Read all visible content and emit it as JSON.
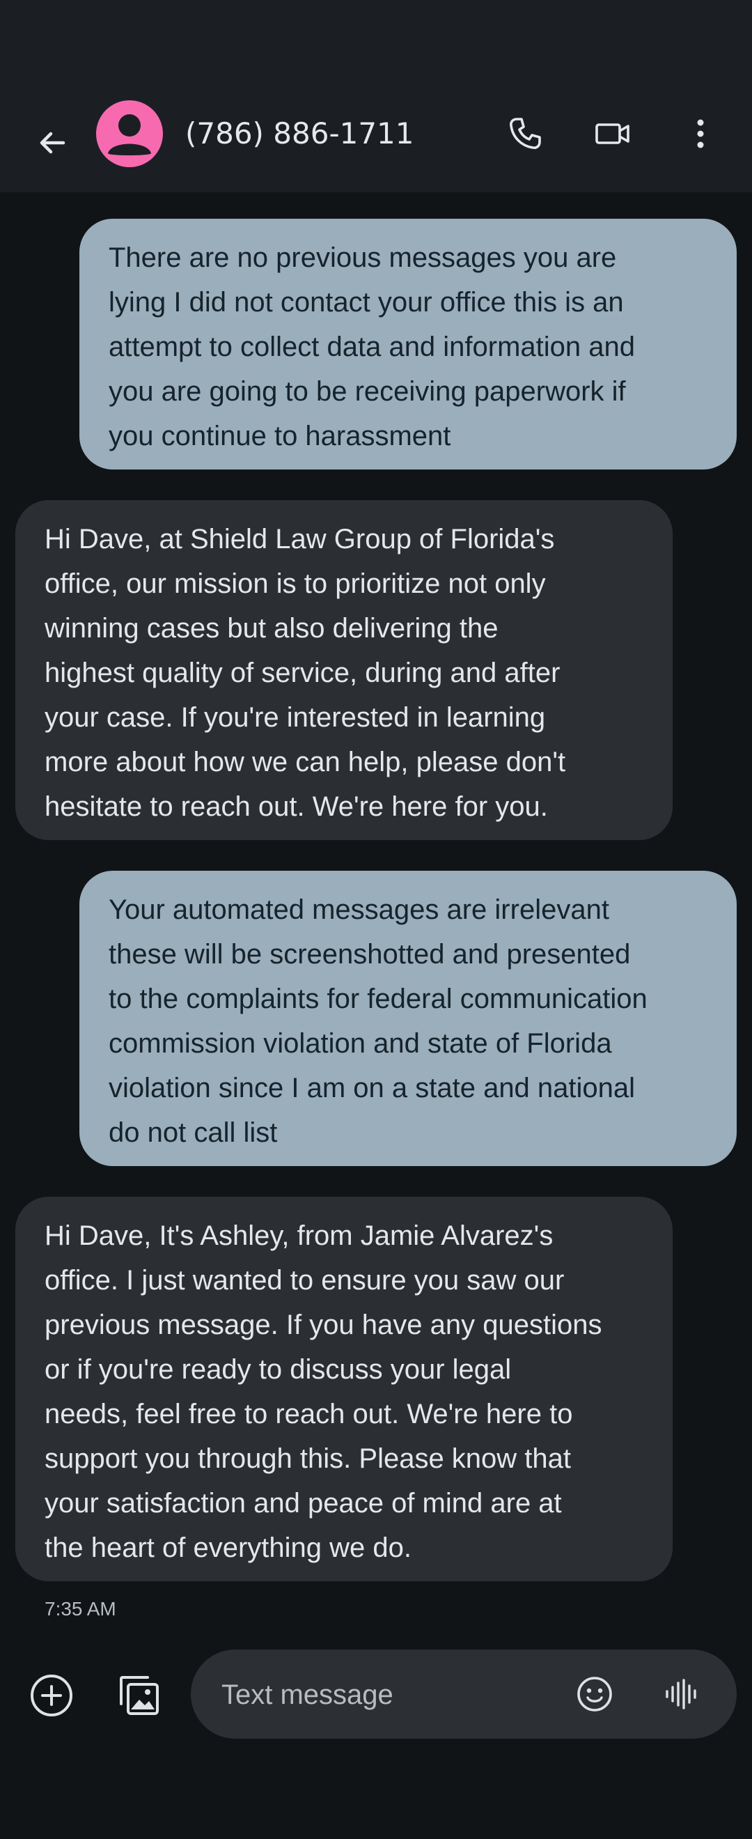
{
  "header": {
    "contact": "(786) 886-1711",
    "back_icon": "arrow-back-icon",
    "avatar_icon": "person-icon",
    "call_icon": "phone-icon",
    "video_icon": "video-camera-icon",
    "more_icon": "more-vert-icon"
  },
  "messages": [
    {
      "direction": "outgoing",
      "text": "There are no previous messages you are\nlying I did not contact your office this is an\nattempt to collect data and information and\nyou are going to be receiving paperwork if\nyou continue to harassment"
    },
    {
      "direction": "incoming",
      "text": "Hi Dave, at Shield Law Group of Florida's\noffice, our mission is to prioritize not only\nwinning cases but also delivering the\nhighest quality of service, during and after\nyour case. If you're interested in learning\nmore about how we can help, please don't\nhesitate to reach out. We're here for you."
    },
    {
      "direction": "outgoing",
      "text": "Your automated messages are irrelevant\nthese will be screenshotted and presented\nto the complaints for federal communication\ncommission violation and state of Florida\nviolation since I am on a state and national\ndo not call list"
    },
    {
      "direction": "incoming",
      "text": "Hi Dave, It's Ashley, from Jamie Alvarez's\noffice. I just wanted to ensure you saw our\nprevious message. If you have any questions\nor if you're ready to discuss your legal\nneeds, feel free to reach out. We're here to\nsupport you through this. Please know that\nyour satisfaction and peace of mind are at\nthe heart of everything we do."
    }
  ],
  "timestamp": "7:35 AM",
  "composer": {
    "placeholder": "Text message",
    "add_icon": "add-circle-icon",
    "gallery_icon": "gallery-icon",
    "emoji_icon": "emoji-icon",
    "voice_icon": "voice-waveform-icon"
  },
  "colors": {
    "background": "#111417",
    "appbar": "#1b1f24",
    "outgoing_bubble": "#9aaebb",
    "incoming_bubble": "#2b2f33",
    "avatar": "#f76ab0"
  }
}
